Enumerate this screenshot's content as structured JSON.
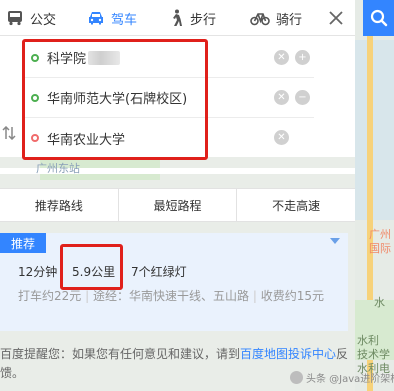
{
  "modes": [
    {
      "label": "公交",
      "icon": "bus-icon"
    },
    {
      "label": "驾车",
      "icon": "car-icon"
    },
    {
      "label": "步行",
      "icon": "walk-icon"
    },
    {
      "label": "骑行",
      "icon": "bike-icon"
    }
  ],
  "stops": {
    "start": "科学院",
    "via": "华南师范大学(石牌校区)",
    "end": "华南农业大学"
  },
  "map_labels": {
    "faded": "广州东站",
    "right_1": "广州",
    "right_2": "国际",
    "right_3": "水利",
    "right_4": "技术学",
    "right_5": "水利电",
    "right_6": "水"
  },
  "strategy_tabs": [
    "推荐路线",
    "最短路程",
    "不走高速"
  ],
  "route": {
    "badge": "推荐",
    "time": "12分钟",
    "distance": "5.9公里",
    "lights": "7个红绿灯",
    "taxi": "打车约22元",
    "via_prefix": "途经：",
    "via_roads": "华南快速干线、五山路",
    "toll": "收费约15元"
  },
  "feedback": {
    "text_before": "百度提醒您：如果您有任何意见和建议，请到",
    "link": "百度地图投诉中心",
    "text_after": "反馈。"
  },
  "watermark": "头条 @Java进阶架构师",
  "colors": {
    "accent": "#3385ff",
    "highlight_box": "#e0201b",
    "start_dot": "#4caf50",
    "end_dot": "#f06b6b"
  }
}
